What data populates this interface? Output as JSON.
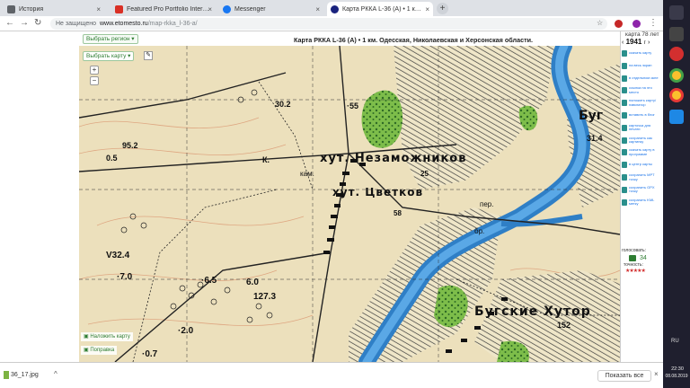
{
  "tabs": [
    {
      "label": "История",
      "color": "#5f6368",
      "active": false
    },
    {
      "label": "Featured Pro Portfolio Interview",
      "color": "#d93025",
      "active": false
    },
    {
      "label": "Messenger",
      "color": "#1877f2",
      "active": false
    },
    {
      "label": "Карта РККА L-36 (А) • 1 км. Одес",
      "color": "#1a237e",
      "active": true
    }
  ],
  "toolbar": {
    "not_secure": "Не защищено",
    "domain": "www.etomesto.ru",
    "path": "/map-rkka_l-36-a/"
  },
  "header": {
    "region_button": "Выбрать регион",
    "map_button": "Выбрать карту",
    "title": "Карта РККА L-36 (А) • 1 км. Одесская, Николаевская и Херсонская области.",
    "karta_age": "карта 78 лет",
    "year": "1941",
    "year_suffix": "г"
  },
  "map": {
    "labels": {
      "niezamozh": "хут. Незаможников",
      "tsvetkov": "хут. Цветков",
      "bugskie": "Бугские Хутор",
      "bug": "Буг",
      "h95": "95.2",
      "h05": "0.5",
      "h302": "30.2",
      "h55": "·55",
      "k": "К.",
      "kam": "кам.",
      "v324": "V32.4",
      "h70": "·7.0",
      "h65": "·6.5",
      "h60": "6.0",
      "h1273": "127.3",
      "h20": "·2.0",
      "h07": "·0.7",
      "h25": "25",
      "h58": "58",
      "per": "пер.",
      "br": "бр.",
      "h152": "152",
      "h314": "31.4"
    },
    "add_map_link": "Наложить карту",
    "edit_link": "Поправка",
    "zoom_in": "+",
    "zoom_out": "−"
  },
  "right_panel": {
    "items": [
      "скачать карту",
      "на весь экран",
      "в отдельном окне",
      "ссылка на это место",
      "наложить карту/навигатор",
      "вставить в блог",
      "карточка для печати",
      "сохранить как картинку",
      "скачать карту в программе",
      "в центр карты",
      "сохранить MPT точку",
      "сохранить GPX точку",
      "сохранить KML метку"
    ],
    "votes_label": "голосовать:",
    "votes_count": "34",
    "accuracy_label": "точность:",
    "stars": "★★★★★"
  },
  "downloads": {
    "file": "36_17.jpg",
    "show_all": "Показать все"
  },
  "taskbar": {
    "lang": "RU",
    "time": "22:30",
    "date": "08.08.2019"
  }
}
